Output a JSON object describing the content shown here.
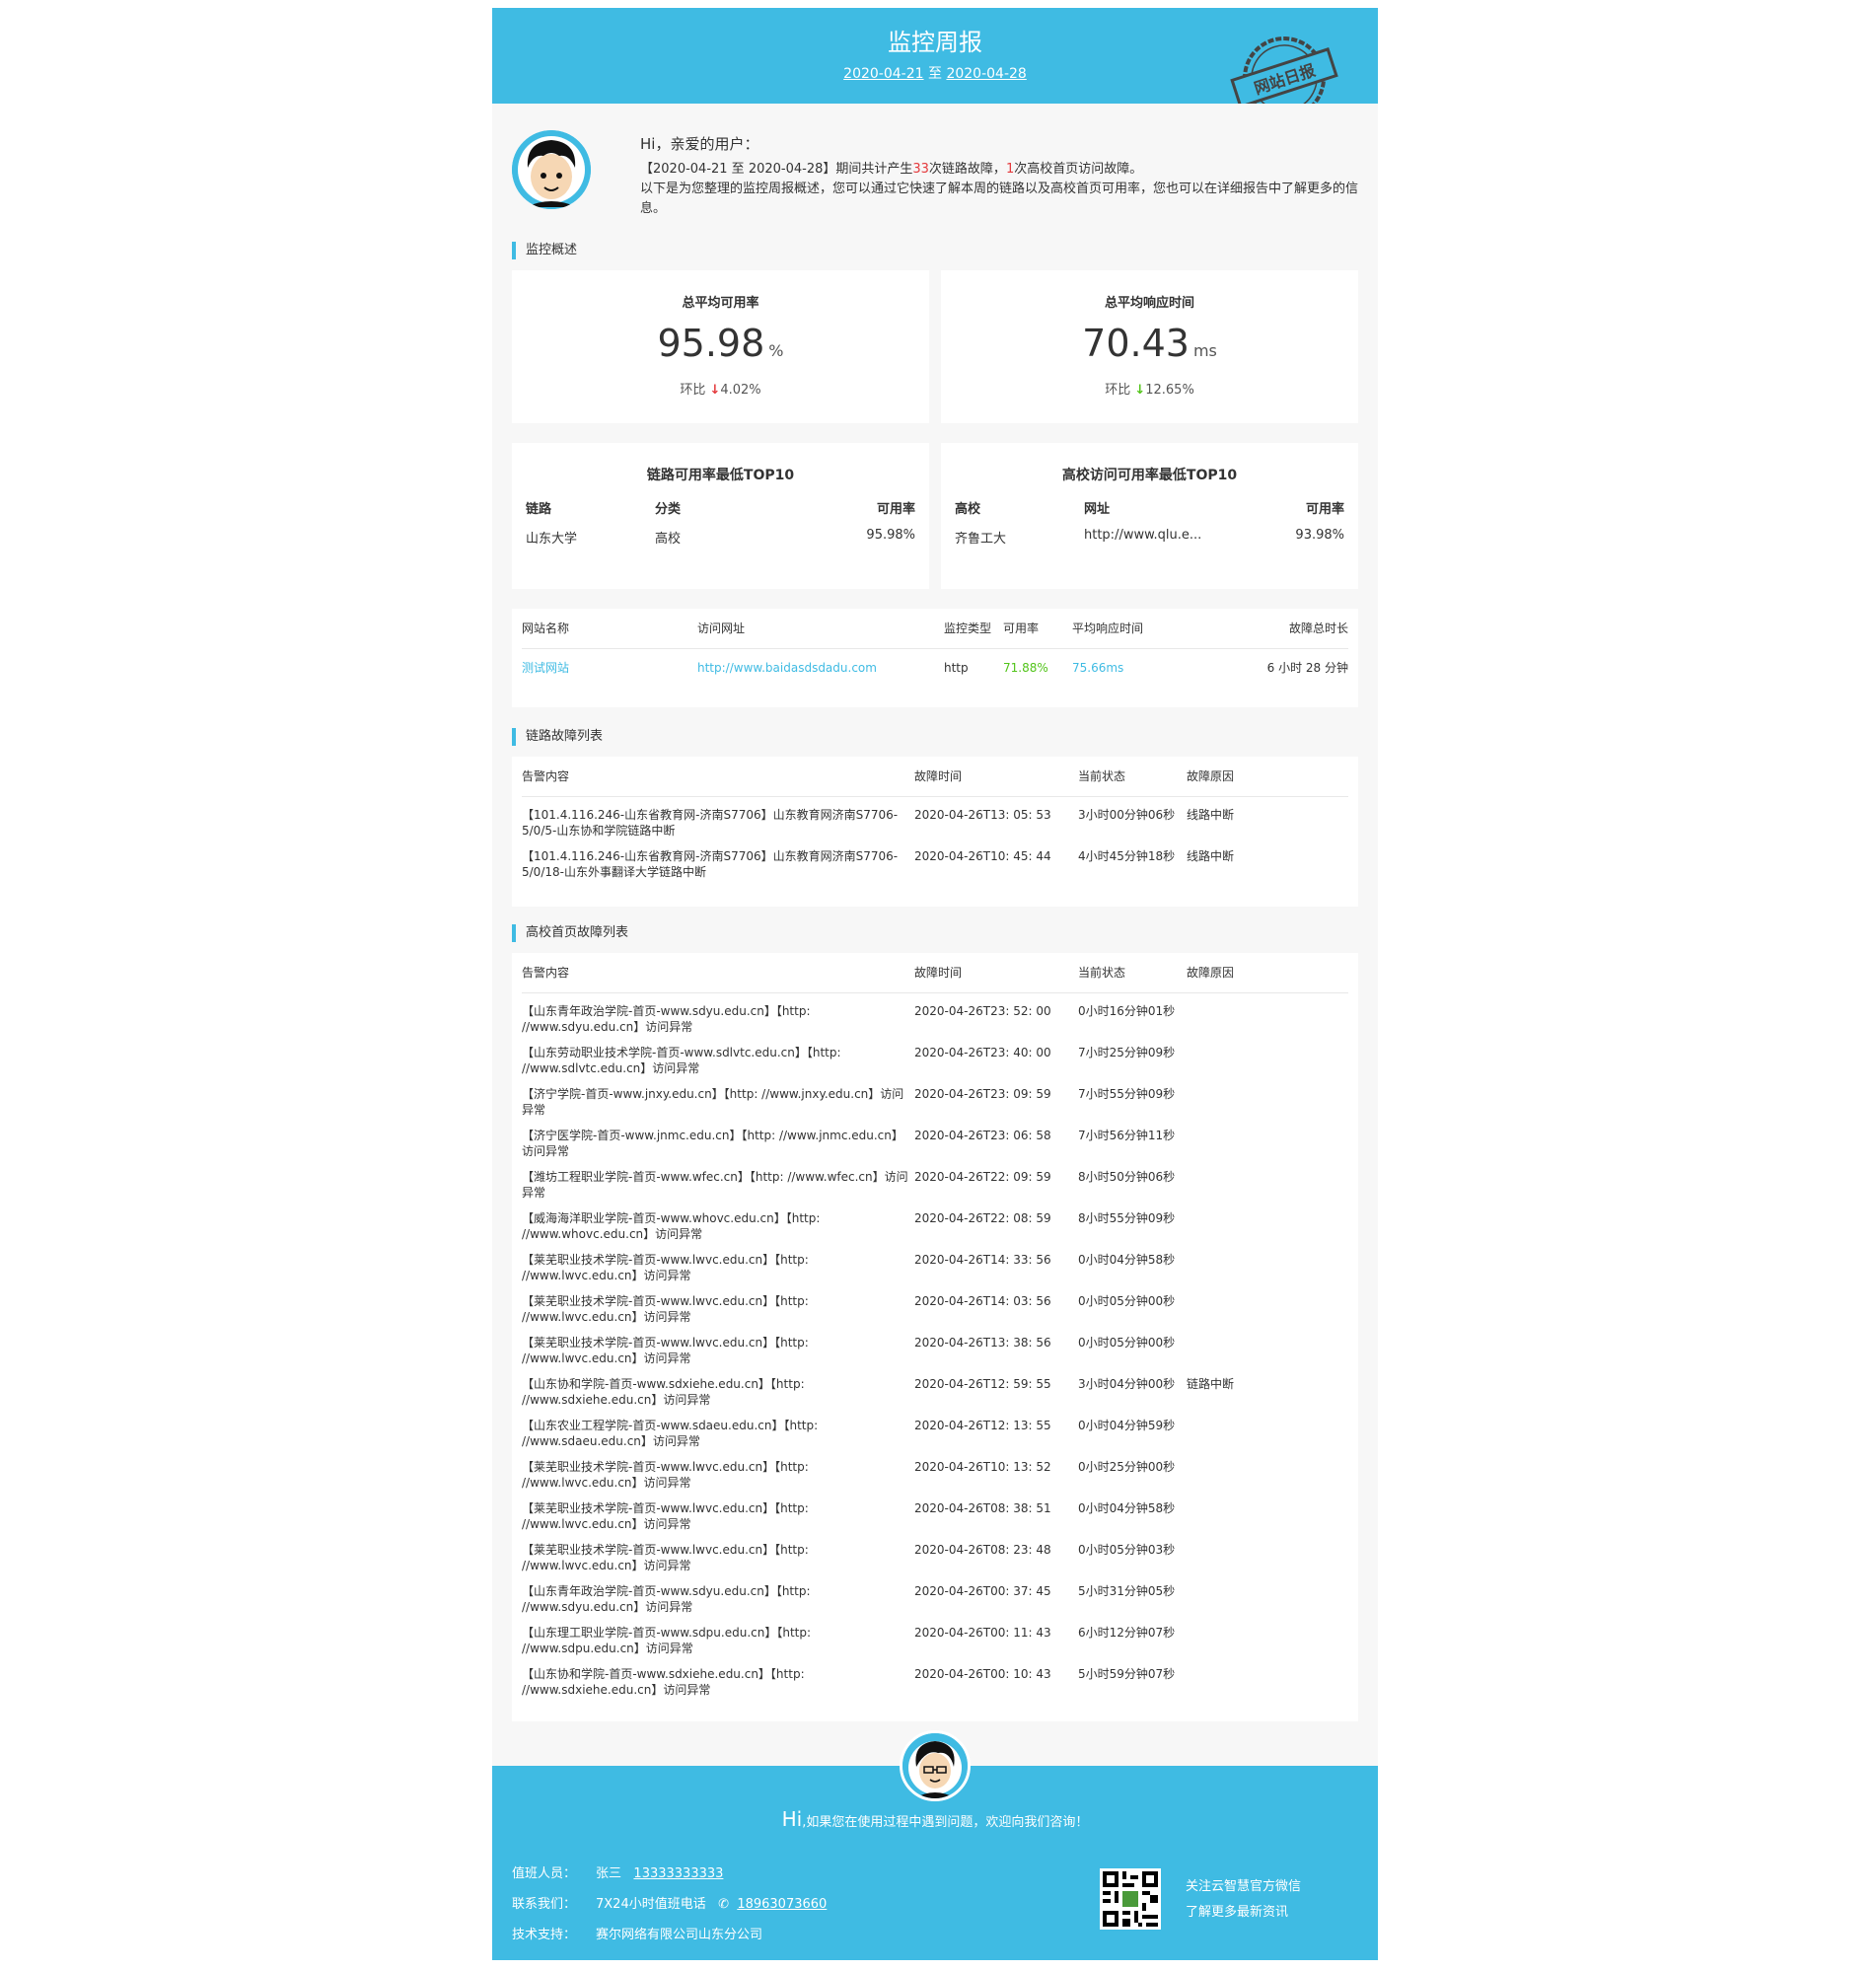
{
  "header": {
    "title": "监控周报",
    "range_start": "2020-04-21",
    "range_sep": " 至 ",
    "range_end": "2020-04-28",
    "stamp_text": "网站日报"
  },
  "greeting": {
    "hi": "Hi，亲爱的用户：",
    "line1_pre": "【2020-04-21 至 2020-04-28】期间共计产生",
    "link_faults": "33",
    "line1_mid": "次链路故障，",
    "home_faults": "1",
    "line1_post": "次高校首页访问故障。",
    "line2": "以下是为您整理的监控周报概述，您可以通过它快速了解本周的链路以及高校首页可用率，您也可以在详细报告中了解更多的信息。"
  },
  "overview": {
    "section_title": "监控概述",
    "availability": {
      "label": "总平均可用率",
      "value": "95.98",
      "unit": "%",
      "ratio_label": "环比 ",
      "arrow": "↓",
      "ratio": "4.02%"
    },
    "response": {
      "label": "总平均响应时间",
      "value": "70.43",
      "unit": "ms",
      "ratio_label": "环比 ",
      "arrow": "↓",
      "ratio": "12.65%"
    }
  },
  "link_top": {
    "title": "链路可用率最低TOP10",
    "headers": [
      "链路",
      "分类",
      "可用率"
    ],
    "rows": [
      [
        "山东大学",
        "高校",
        "95.98%"
      ]
    ]
  },
  "school_top": {
    "title": "高校访问可用率最低TOP10",
    "headers": [
      "高校",
      "网址",
      "可用率"
    ],
    "rows": [
      [
        "齐鲁工大",
        "http://www.qlu.e...",
        "93.98%"
      ]
    ]
  },
  "site_table": {
    "headers": [
      "网站名称",
      "访问网址",
      "监控类型",
      "可用率",
      "平均响应时间",
      "故障总时长"
    ],
    "rows": [
      [
        "测试网站",
        "http://www.baidasdsdadu.com",
        "http",
        "71.88%",
        "75.66ms",
        "6 小时 28 分钟"
      ]
    ]
  },
  "link_faults": {
    "section_title": "链路故障列表",
    "headers": [
      "告警内容",
      "故障时间",
      "当前状态",
      "故障原因"
    ],
    "rows": [
      [
        "【101.4.116.246-山东省教育网-济南S7706】山东教育网济南S7706-5/0/5-山东协和学院链路中断",
        "2020-04-26T13: 05: 53",
        "3小时00分钟06秒",
        "线路中断"
      ],
      [
        "【101.4.116.246-山东省教育网-济南S7706】山东教育网济南S7706-5/0/18-山东外事翻译大学链路中断",
        "2020-04-26T10: 45: 44",
        "4小时45分钟18秒",
        "线路中断"
      ]
    ]
  },
  "home_faults": {
    "section_title": "高校首页故障列表",
    "headers": [
      "告警内容",
      "故障时间",
      "当前状态",
      "故障原因"
    ],
    "rows": [
      [
        "【山东青年政治学院-首页-www.sdyu.edu.cn】【http: //www.sdyu.edu.cn】访问异常",
        "2020-04-26T23: 52: 00",
        "0小时16分钟01秒",
        ""
      ],
      [
        "【山东劳动职业技术学院-首页-www.sdlvtc.edu.cn】【http: //www.sdlvtc.edu.cn】访问异常",
        "2020-04-26T23: 40: 00",
        "7小时25分钟09秒",
        ""
      ],
      [
        "【济宁学院-首页-www.jnxy.edu.cn】【http: //www.jnxy.edu.cn】访问异常",
        "2020-04-26T23: 09: 59",
        "7小时55分钟09秒",
        ""
      ],
      [
        "【济宁医学院-首页-www.jnmc.edu.cn】【http: //www.jnmc.edu.cn】访问异常",
        "2020-04-26T23: 06: 58",
        "7小时56分钟11秒",
        ""
      ],
      [
        "【潍坊工程职业学院-首页-www.wfec.cn】【http: //www.wfec.cn】访问异常",
        "2020-04-26T22: 09: 59",
        "8小时50分钟06秒",
        ""
      ],
      [
        "【威海海洋职业学院-首页-www.whovc.edu.cn】【http: //www.whovc.edu.cn】访问异常",
        "2020-04-26T22: 08: 59",
        "8小时55分钟09秒",
        ""
      ],
      [
        "【莱芜职业技术学院-首页-www.lwvc.edu.cn】【http: //www.lwvc.edu.cn】访问异常",
        "2020-04-26T14: 33: 56",
        "0小时04分钟58秒",
        ""
      ],
      [
        "【莱芜职业技术学院-首页-www.lwvc.edu.cn】【http: //www.lwvc.edu.cn】访问异常",
        "2020-04-26T14: 03: 56",
        "0小时05分钟00秒",
        ""
      ],
      [
        "【莱芜职业技术学院-首页-www.lwvc.edu.cn】【http: //www.lwvc.edu.cn】访问异常",
        "2020-04-26T13: 38: 56",
        "0小时05分钟00秒",
        ""
      ],
      [
        "【山东协和学院-首页-www.sdxiehe.edu.cn】【http: //www.sdxiehe.edu.cn】访问异常",
        "2020-04-26T12: 59: 55",
        "3小时04分钟00秒",
        "链路中断"
      ],
      [
        "【山东农业工程学院-首页-www.sdaeu.edu.cn】【http: //www.sdaeu.edu.cn】访问异常",
        "2020-04-26T12: 13: 55",
        "0小时04分钟59秒",
        ""
      ],
      [
        "【莱芜职业技术学院-首页-www.lwvc.edu.cn】【http: //www.lwvc.edu.cn】访问异常",
        "2020-04-26T10: 13: 52",
        "0小时25分钟00秒",
        ""
      ],
      [
        "【莱芜职业技术学院-首页-www.lwvc.edu.cn】【http: //www.lwvc.edu.cn】访问异常",
        "2020-04-26T08: 38: 51",
        "0小时04分钟58秒",
        ""
      ],
      [
        "【莱芜职业技术学院-首页-www.lwvc.edu.cn】【http: //www.lwvc.edu.cn】访问异常",
        "2020-04-26T08: 23: 48",
        "0小时05分钟03秒",
        ""
      ],
      [
        "【山东青年政治学院-首页-www.sdyu.edu.cn】【http: //www.sdyu.edu.cn】访问异常",
        "2020-04-26T00: 37: 45",
        "5小时31分钟05秒",
        ""
      ],
      [
        "【山东理工职业学院-首页-www.sdpu.edu.cn】【http: //www.sdpu.edu.cn】访问异常",
        "2020-04-26T00: 11: 43",
        "6小时12分钟07秒",
        ""
      ],
      [
        "【山东协和学院-首页-www.sdxiehe.edu.cn】【http: //www.sdxiehe.edu.cn】访问异常",
        "2020-04-26T00: 10: 43",
        "5小时59分钟07秒",
        ""
      ]
    ]
  },
  "footer": {
    "hi_big": "Hi",
    "hi_text": ",如果您在使用过程中遇到问题，欢迎向我们咨询！",
    "duty_label": "值班人员：",
    "duty_name": "张三",
    "duty_phone": "13333333333",
    "contact_label": "联系我们：",
    "contact_text": "7X24小时值班电话",
    "contact_phone": "18963073660",
    "support_label": "技术支持：",
    "support_text": "赛尔网络有限公司山东分公司",
    "qr_line1": "关注云智慧官方微信",
    "qr_line2": "了解更多最新资讯"
  },
  "colors": {
    "accent": "#3fbbe3",
    "red": "#e4393c",
    "green": "#52c41a",
    "background": "#f7f7f7"
  },
  "icons": {
    "phone": "phone-icon",
    "arrow_down": "arrow-down-icon"
  }
}
